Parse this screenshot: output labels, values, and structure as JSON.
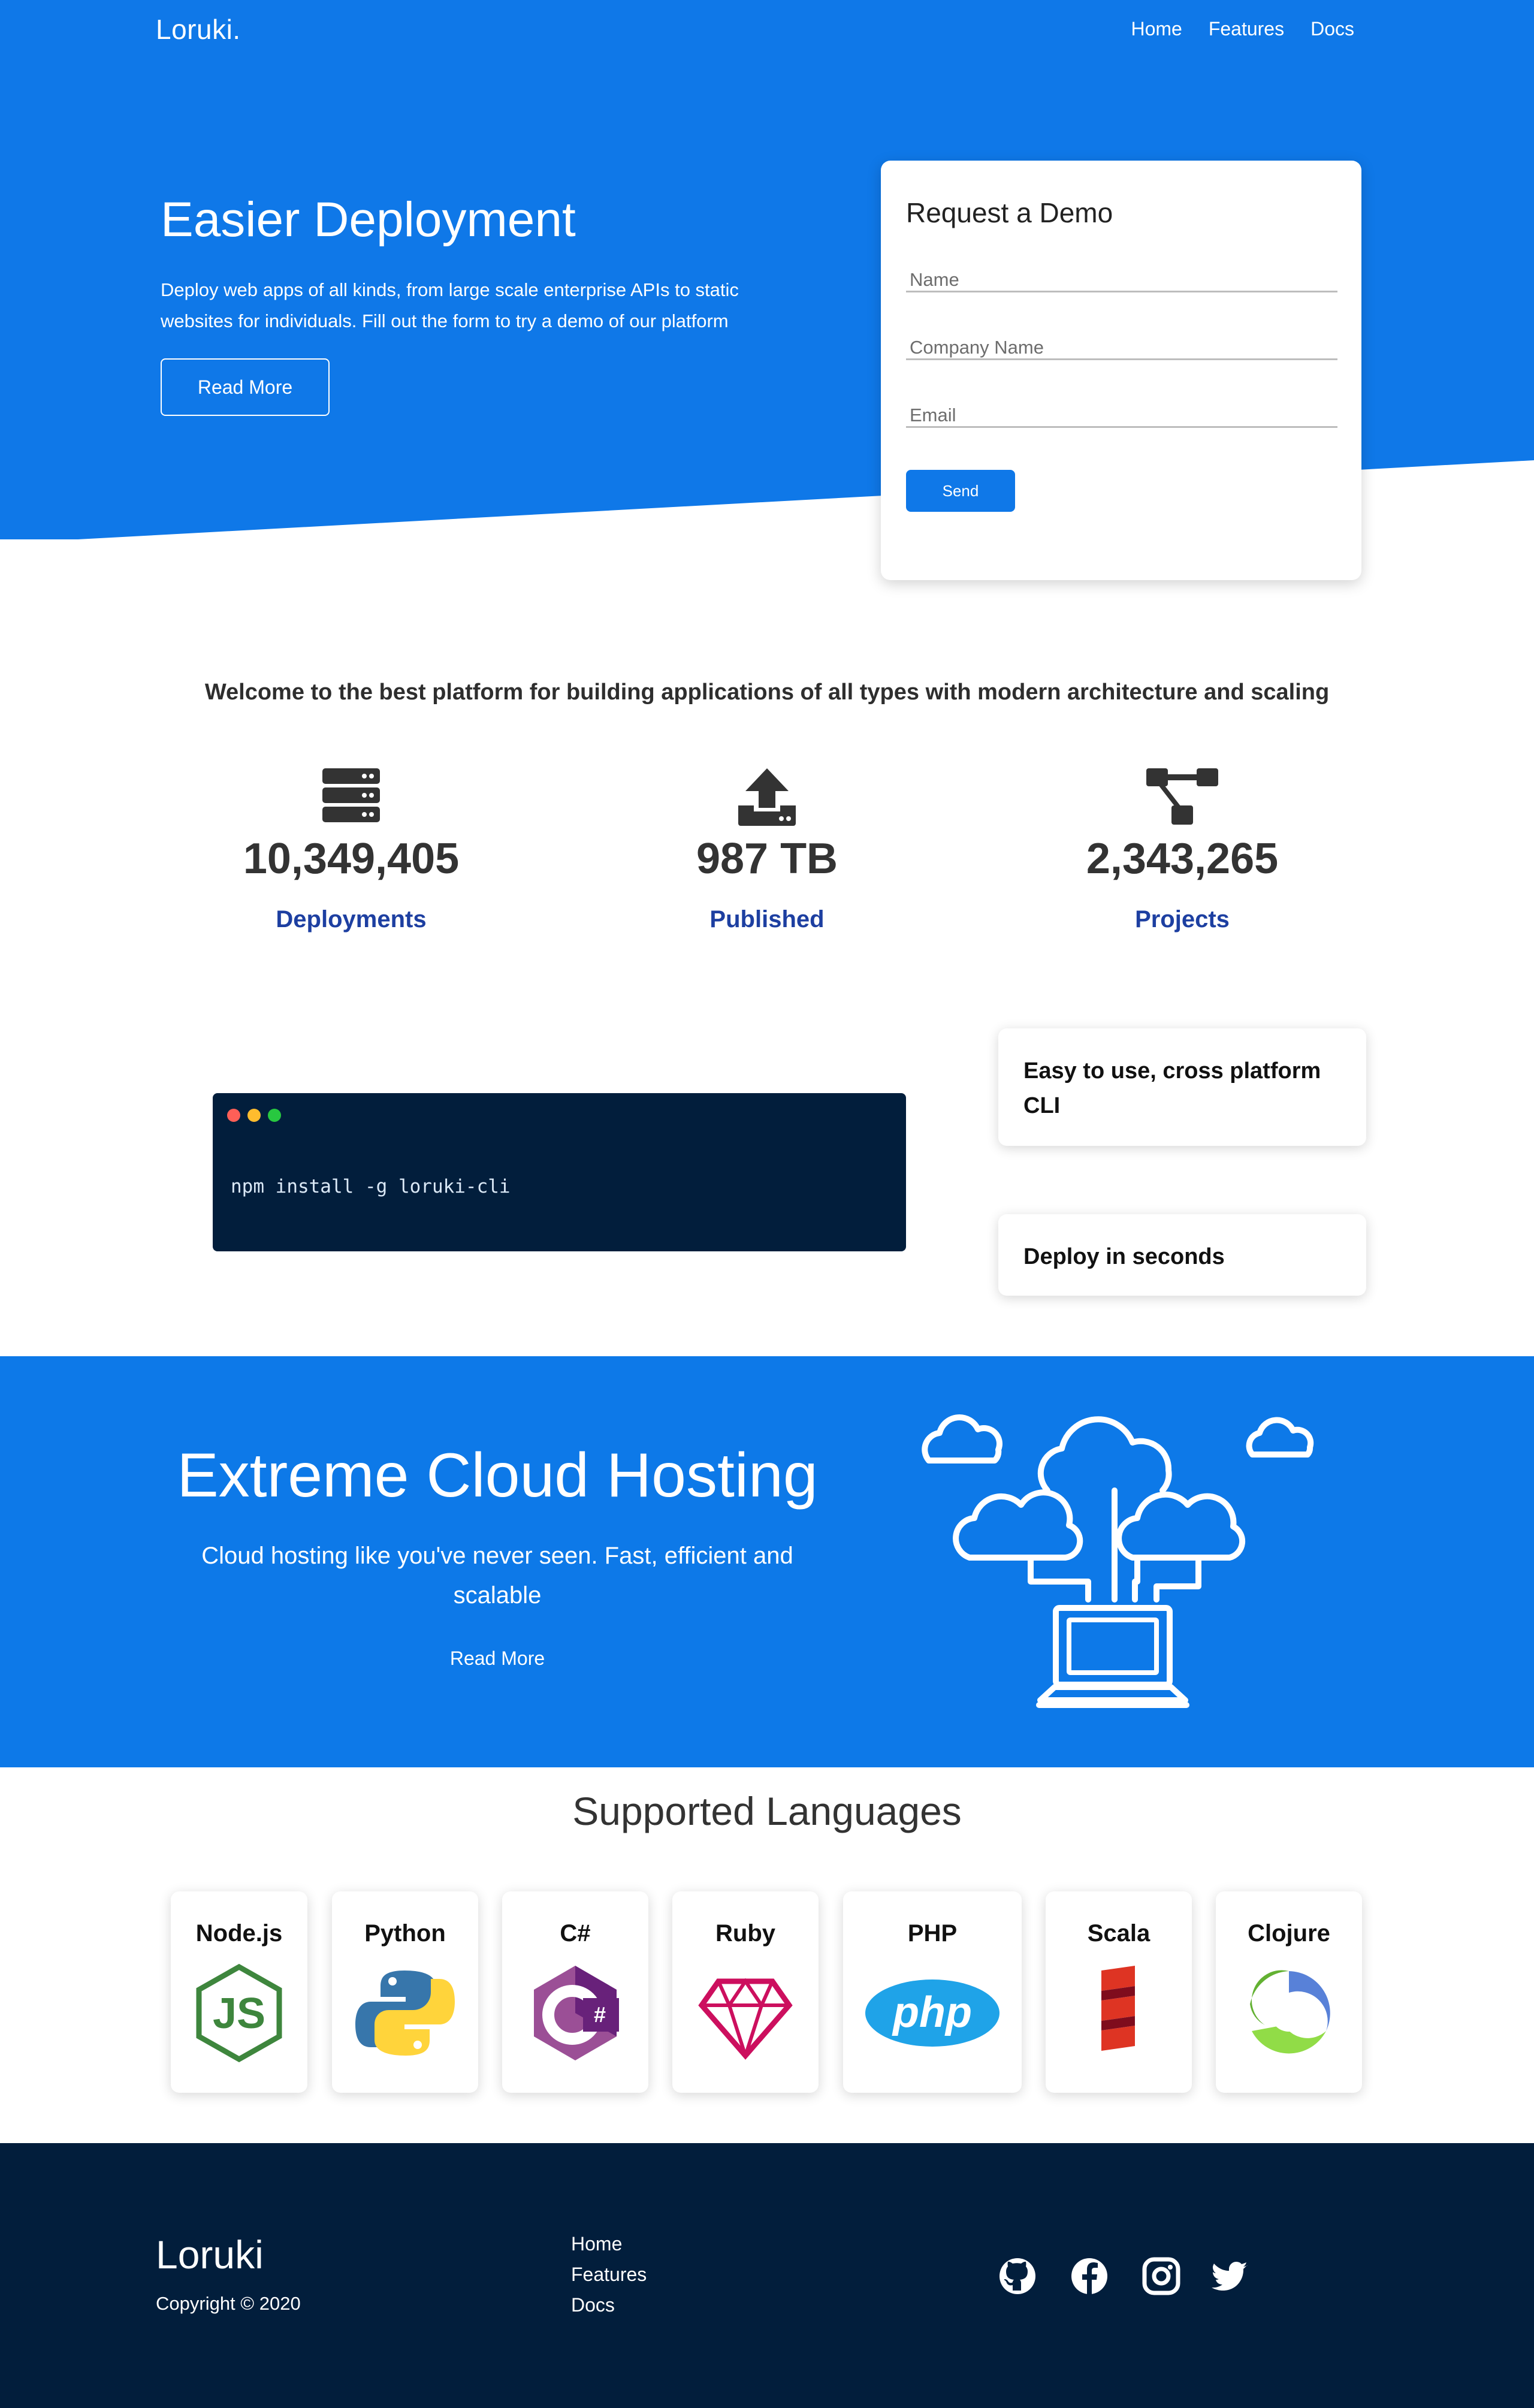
{
  "colors": {
    "primary_blue": "#0f78e8",
    "dark_navy": "#021e3c",
    "stat_label_blue": "#1d3fa1",
    "white": "#ffffff"
  },
  "nav": {
    "logo": "Loruki.",
    "links": [
      "Home",
      "Features",
      "Docs"
    ]
  },
  "hero": {
    "title": "Easier Deployment",
    "description": "Deploy web apps of all kinds, from large scale enterprise APIs to static websites for individuals. Fill out the form to try a demo of our platform",
    "read_more": "Read More"
  },
  "demo_form": {
    "title": "Request a Demo",
    "name_placeholder": "Name",
    "company_placeholder": "Company Name",
    "email_placeholder": "Email",
    "send_label": "Send"
  },
  "welcome": "Welcome to the best platform for building applications of all types with modern architecture and scaling",
  "stats": [
    {
      "icon": "server-icon",
      "value": "10,349,405",
      "label": "Deployments"
    },
    {
      "icon": "upload-icon",
      "value": "987 TB",
      "label": "Published"
    },
    {
      "icon": "project-diagram-icon",
      "value": "2,343,265",
      "label": "Projects"
    }
  ],
  "terminal": {
    "command": "npm install -g loruki-cli"
  },
  "features": [
    "Easy to use, cross platform CLI",
    "Deploy in seconds"
  ],
  "cloud": {
    "title": "Extreme Cloud Hosting",
    "description": "Cloud hosting like you've never seen. Fast, efficient and scalable",
    "read_more": "Read More"
  },
  "languages": {
    "title": "Supported Languages",
    "items": [
      {
        "name": "Node.js",
        "icon": "nodejs-logo"
      },
      {
        "name": "Python",
        "icon": "python-logo"
      },
      {
        "name": "C#",
        "icon": "csharp-logo"
      },
      {
        "name": "Ruby",
        "icon": "ruby-logo"
      },
      {
        "name": "PHP",
        "icon": "php-logo"
      },
      {
        "name": "Scala",
        "icon": "scala-logo"
      },
      {
        "name": "Clojure",
        "icon": "clojure-logo"
      }
    ]
  },
  "footer": {
    "logo": "Loruki",
    "copyright": "Copyright © 2020",
    "links": [
      "Home",
      "Features",
      "Docs"
    ],
    "social": [
      "github-icon",
      "facebook-icon",
      "instagram-icon",
      "twitter-icon"
    ]
  }
}
